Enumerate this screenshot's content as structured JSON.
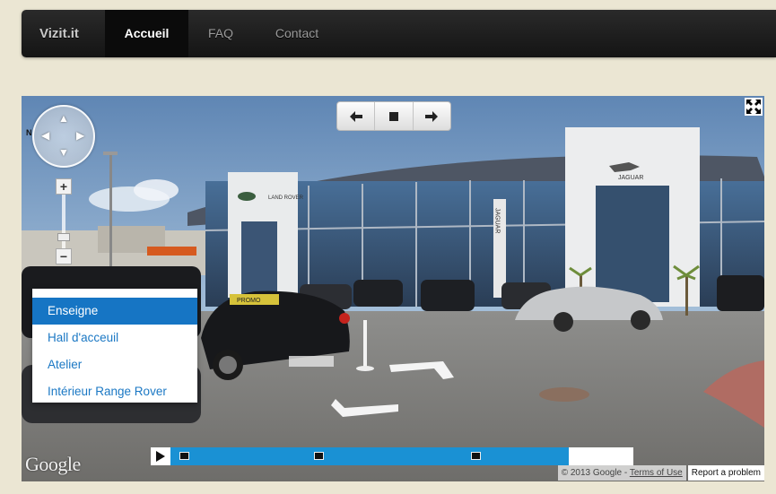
{
  "navbar": {
    "brand": "Vizit.it",
    "items": [
      {
        "label": "Accueil",
        "active": true
      },
      {
        "label": "FAQ",
        "active": false
      },
      {
        "label": "Contact",
        "active": false
      }
    ]
  },
  "viewer": {
    "nav_arrows": {
      "left_icon": "arrow-left-icon",
      "stop_icon": "stop-icon",
      "right_icon": "arrow-right-icon"
    },
    "compass_label": "N",
    "zoom_in_label": "+",
    "zoom_out_label": "−",
    "locations": [
      "Enseigne",
      "Hall d'acceuil",
      "Atelier",
      "Intérieur Range Rover"
    ],
    "active_location": "Enseigne",
    "timeline": {
      "progress": 0.86,
      "markers": [
        0.02,
        0.31,
        0.65
      ]
    },
    "google_logo": "Google",
    "attribution": {
      "copyright": "© 2013 Google",
      "separator": " - ",
      "terms_link": "Terms of Use",
      "report_link": "Report a problem"
    },
    "signage": {
      "left_building": "LAND ROVER",
      "right_building": "JAGUAR",
      "banner": "JAGUAR",
      "car_plate": "PROMO"
    },
    "colors": {
      "accent": "#1675c4",
      "timeline": "#1a91d4",
      "navbar": "#1a1a1a"
    }
  }
}
